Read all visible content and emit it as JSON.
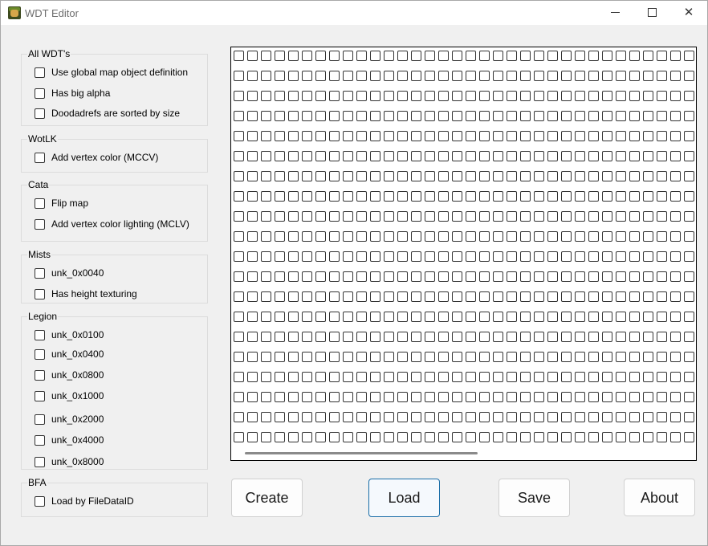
{
  "window": {
    "title": "WDT Editor",
    "controls": {
      "minimize": "minimize",
      "maximize": "maximize",
      "close": "✕"
    }
  },
  "groups": {
    "all_wdts": {
      "title": "All WDT's",
      "items": [
        {
          "label": "Use global map object definition",
          "checked": false
        },
        {
          "label": "Has big alpha",
          "checked": false
        },
        {
          "label": "Doodadrefs are sorted by size",
          "checked": false
        }
      ]
    },
    "wotlk": {
      "title": "WotLK",
      "items": [
        {
          "label": "Add vertex color (MCCV)",
          "checked": false
        }
      ]
    },
    "cata": {
      "title": "Cata",
      "items": [
        {
          "label": "Flip map",
          "checked": false
        },
        {
          "label": "Add vertex color lighting (MCLV)",
          "checked": false
        }
      ]
    },
    "mists": {
      "title": "Mists",
      "items": [
        {
          "label": "unk_0x0040",
          "checked": false
        },
        {
          "label": "Has height texturing",
          "checked": false
        }
      ]
    },
    "legion": {
      "title": "Legion",
      "items": [
        {
          "label": "unk_0x0100",
          "checked": false
        },
        {
          "label": "unk_0x0400",
          "checked": false
        },
        {
          "label": "unk_0x0800",
          "checked": false
        },
        {
          "label": "unk_0x1000",
          "checked": false
        },
        {
          "label": "unk_0x2000",
          "checked": false
        },
        {
          "label": "unk_0x4000",
          "checked": false
        },
        {
          "label": "unk_0x8000",
          "checked": false
        }
      ]
    },
    "bfa": {
      "title": "BFA",
      "items": [
        {
          "label": "Load by FileDataID",
          "checked": false
        }
      ]
    }
  },
  "tile_grid": {
    "visible_columns": 34,
    "visible_rows": 20,
    "all_checked": false
  },
  "buttons": {
    "create": "Create",
    "load": "Load",
    "save": "Save",
    "about": "About"
  },
  "colors": {
    "window_bg": "#f0f0f0",
    "titlebar_bg": "#ffffff",
    "focus_border": "#1a6ea8"
  }
}
